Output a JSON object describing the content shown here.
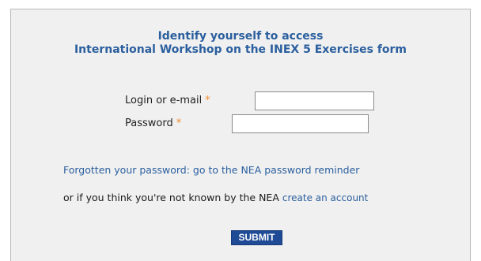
{
  "form": {
    "title_line1": "Identify yourself to access",
    "title_line2": "International Workshop on the INEX 5 Exercises form",
    "login_label": "Login or e-mail",
    "password_label": "Password",
    "required_marker": "*",
    "login_value": "",
    "password_value": "",
    "forgot_link": "Forgotten your password: go to the NEA password reminder",
    "unknown_text": "or if you think you're not known by the NEA",
    "create_account_link": "create an account",
    "submit_label": "SUBMIT"
  },
  "colors": {
    "title": "#2b5f9e",
    "link": "#2b5f9e",
    "required": "#f28c28",
    "submit_bg": "#1f4a95",
    "panel_bg": "#f0f0f0"
  }
}
